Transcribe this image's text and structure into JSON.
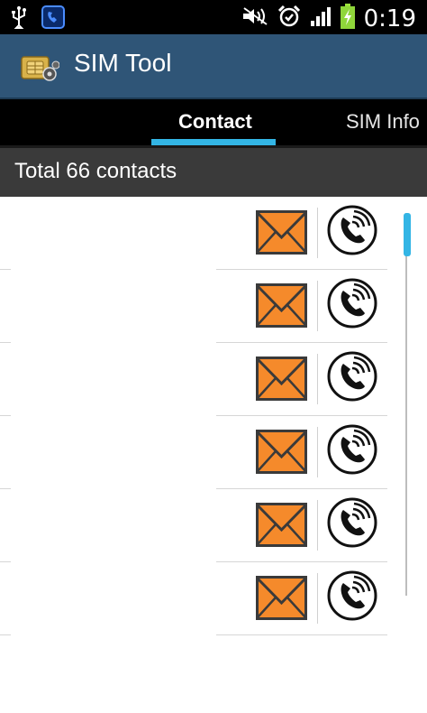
{
  "status_bar": {
    "time": "0:19",
    "icons": [
      "usb-icon",
      "phone-app-icon",
      "mute-icon",
      "alarm-icon",
      "signal-icon",
      "battery-charging-icon"
    ]
  },
  "app": {
    "title": "SIM Tool"
  },
  "tabs": [
    {
      "label": "Contact",
      "active": true
    },
    {
      "label": "SIM Info",
      "active": false
    }
  ],
  "header": {
    "total_text": "Total 66 contacts"
  },
  "contacts": [
    {
      "name": "",
      "number": ""
    },
    {
      "name": "",
      "number": ""
    },
    {
      "name": "",
      "number": ""
    },
    {
      "name": "",
      "number": ""
    },
    {
      "name": "",
      "number": ""
    },
    {
      "name": "",
      "number": ""
    }
  ],
  "colors": {
    "action_bar": "#2f5577",
    "tab_indicator": "#33b5e5",
    "mail_icon": "#f58a2b",
    "header_bg": "#3a3a3a"
  }
}
